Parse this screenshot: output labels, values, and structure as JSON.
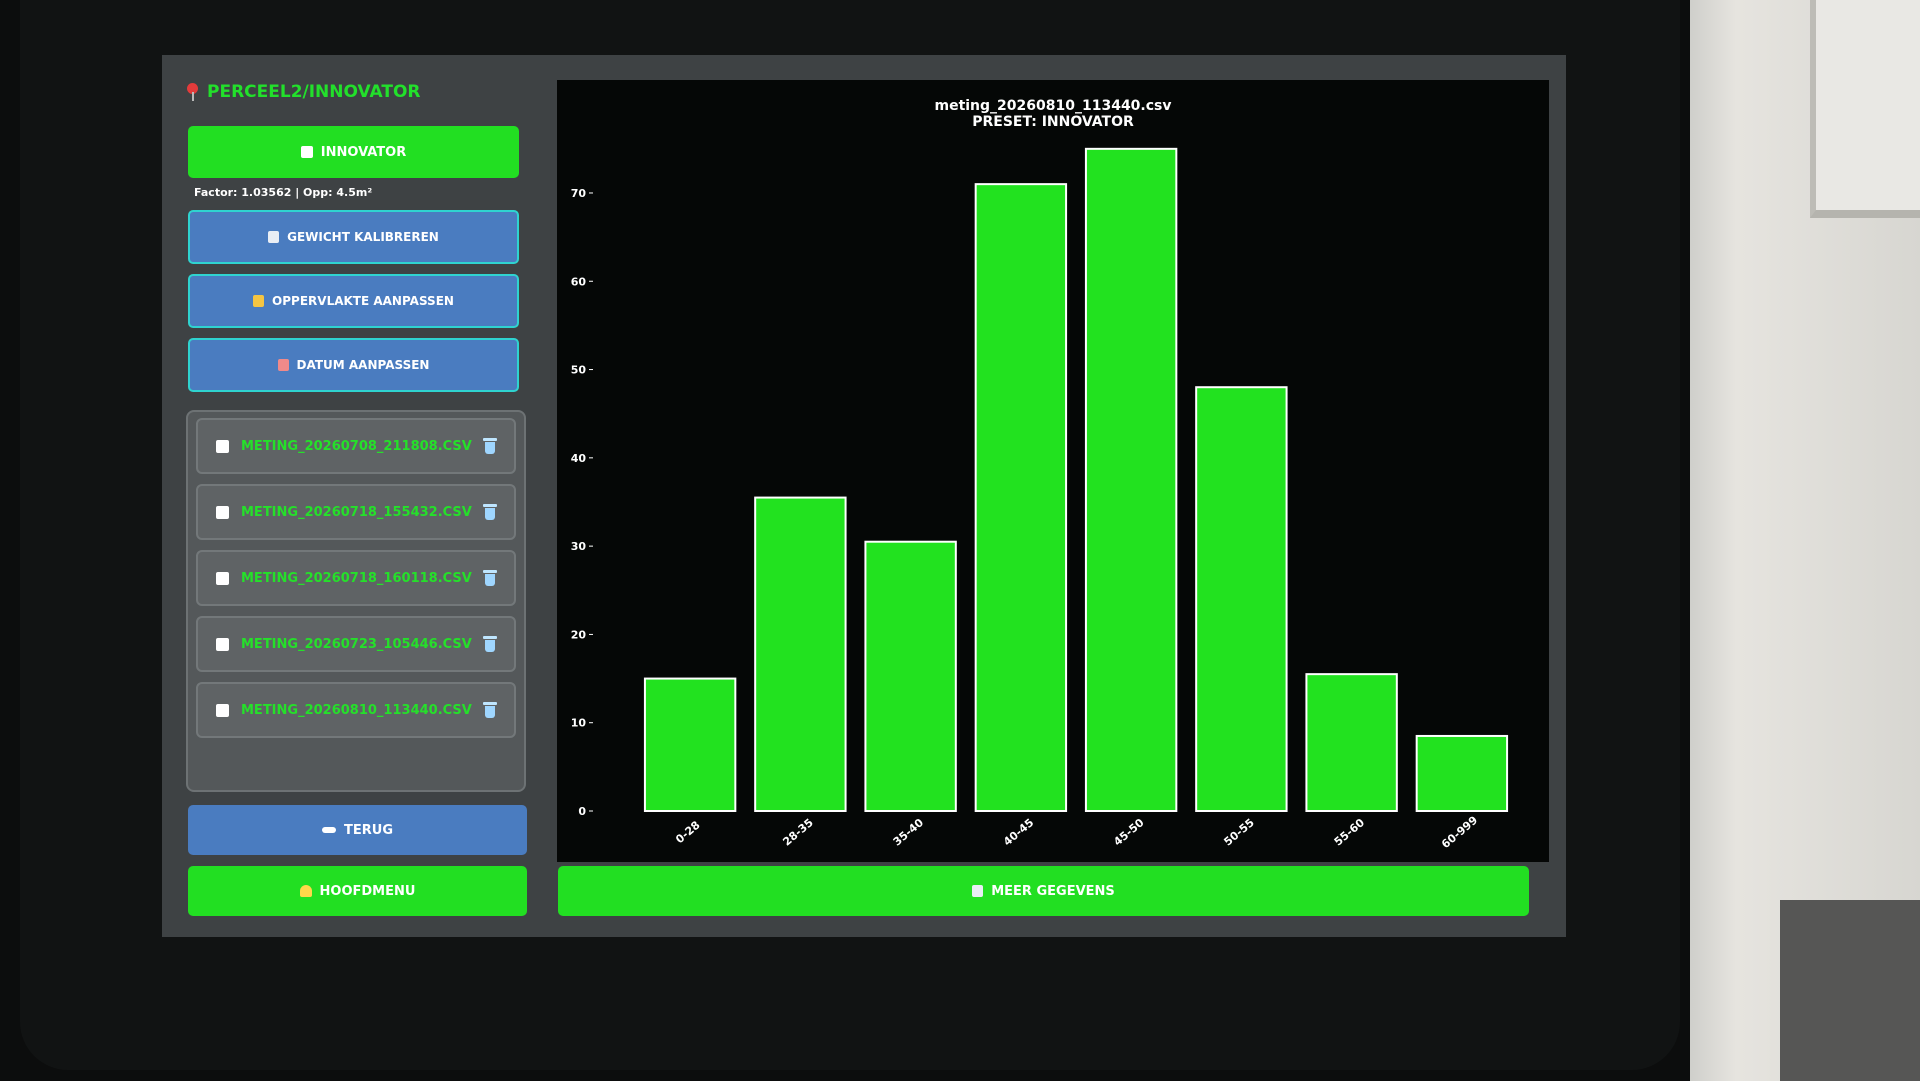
{
  "header": {
    "title": "PERCEEL2/INNOVATOR"
  },
  "buttons": {
    "preset": "INNOVATOR",
    "calibrate": "GEWICHT KALIBREREN",
    "area": "OPPERVLAKTE AANPASSEN",
    "date": "DATUM AANPASSEN",
    "back": "TERUG",
    "main_menu": "HOOFDMENU",
    "more_data": "MEER GEGEVENS"
  },
  "info": {
    "text": "Factor: 1.03562 | Opp: 4.5m²"
  },
  "files": [
    {
      "name": "METING_20260708_211808.CSV"
    },
    {
      "name": "METING_20260718_155432.CSV"
    },
    {
      "name": "METING_20260718_160118.CSV"
    },
    {
      "name": "METING_20260723_105446.CSV"
    },
    {
      "name": "METING_20260810_113440.CSV"
    }
  ],
  "icons": {
    "pin": "map-pin-icon",
    "preset": "document-icon",
    "calibrate": "scale-icon",
    "area": "ruler-icon",
    "date": "calendar-icon",
    "delete": "trash-icon",
    "back": "arrow-left-icon",
    "home": "home-icon",
    "more": "chart-icon"
  },
  "colors": {
    "accent_green": "#22df22",
    "button_blue": "#4a7cc0",
    "button_border": "#2fd3d0",
    "chart_bg": "#050706"
  },
  "chart_data": {
    "type": "bar",
    "title": "meting_20260810_113440.csv",
    "subtitle": "PRESET: INNOVATOR",
    "categories": [
      "0-28",
      "28-35",
      "35-40",
      "40-45",
      "45-50",
      "50-55",
      "55-60",
      "60-999"
    ],
    "values": [
      15,
      35.5,
      30.5,
      71,
      75,
      48,
      15.5,
      8.5
    ],
    "yticks": [
      0,
      10,
      20,
      30,
      40,
      50,
      60,
      70
    ],
    "ylim": [
      0,
      76
    ],
    "xlabel": "",
    "ylabel": "",
    "grid": false,
    "bar_color": "#22e21f",
    "bar_edge": "#ffffff"
  }
}
